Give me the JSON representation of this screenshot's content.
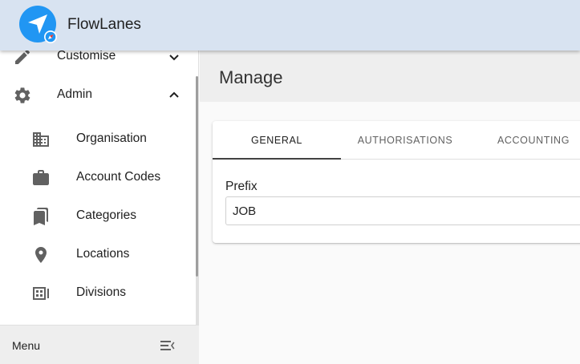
{
  "app": {
    "title": "FlowLanes"
  },
  "sidebar": {
    "items": [
      {
        "label": "Customise",
        "icon": "pencil-icon",
        "expanded": false
      },
      {
        "label": "Admin",
        "icon": "gear-icon",
        "expanded": true
      }
    ],
    "admin_children": [
      {
        "label": "Organisation",
        "icon": "building-icon"
      },
      {
        "label": "Account Codes",
        "icon": "briefcase-icon"
      },
      {
        "label": "Categories",
        "icon": "bookmarks-icon"
      },
      {
        "label": "Locations",
        "icon": "location-pin-icon"
      },
      {
        "label": "Divisions",
        "icon": "divisions-icon"
      }
    ],
    "footer": {
      "label": "Menu",
      "toggle_icon": "menu-collapse-icon"
    }
  },
  "main": {
    "title": "Manage",
    "tabs": [
      {
        "label": "GENERAL",
        "active": true
      },
      {
        "label": "AUTHORISATIONS",
        "active": false
      },
      {
        "label": "ACCOUNTING",
        "active": false
      }
    ],
    "fields": {
      "prefix": {
        "label": "Prefix",
        "value": "JOB"
      }
    }
  },
  "colors": {
    "appbar": "#d8e3f1",
    "logo_blue": "#2196f3",
    "icon_grey": "#616161"
  }
}
